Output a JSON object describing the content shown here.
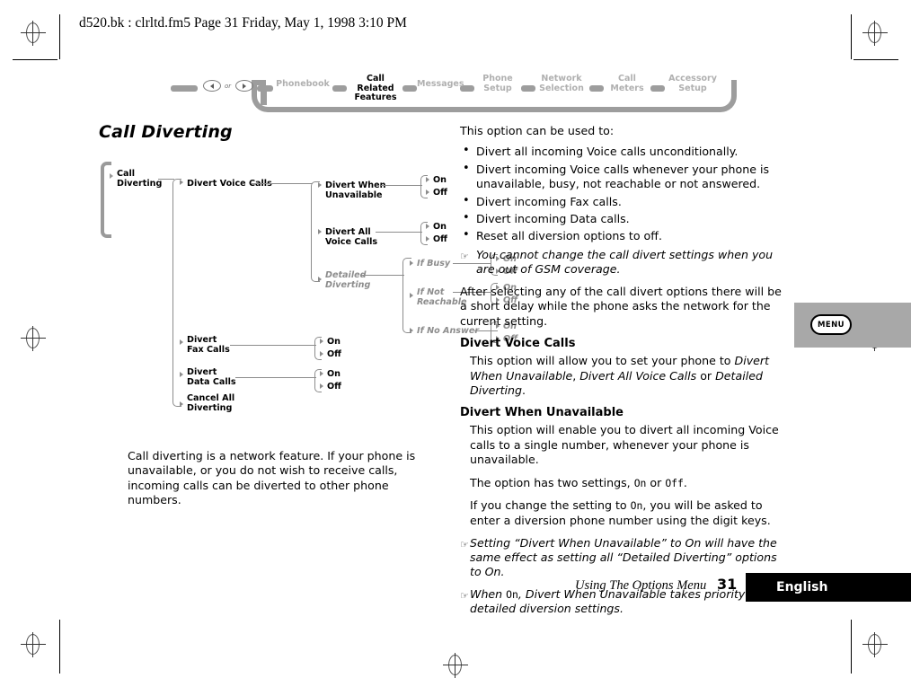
{
  "page_header": "d520.bk : clrltd.fm5  Page 31  Friday, May 1, 1998  3:10 PM",
  "nav": {
    "or_label": "or",
    "left_key_icon": "arrow-left-icon",
    "right_key_icon": "arrow-right-icon",
    "tabs": [
      {
        "label": "Phonebook",
        "active": false
      },
      {
        "label": "Call Related\nFeatures",
        "active": true
      },
      {
        "label": "Messages",
        "active": false
      },
      {
        "label": "Phone\nSetup",
        "active": false
      },
      {
        "label": "Network\nSelection",
        "active": false
      },
      {
        "label": "Call\nMeters",
        "active": false
      },
      {
        "label": "Accessory\nSetup",
        "active": false
      }
    ]
  },
  "heading": "Call Diverting",
  "diagram": {
    "root": "Call Diverting",
    "branches": [
      "Divert Voice Calls",
      "Divert Fax Calls",
      "Divert Data Calls",
      "Cancel All Diverting"
    ],
    "voice_children": [
      "Divert When Unavailable",
      "Divert All Voice Calls",
      "Detailed Diverting"
    ],
    "detailed_children": [
      "If Busy",
      "If Not Reachable",
      "If No Answer"
    ],
    "on": "On",
    "off": "Off"
  },
  "caption": "Call diverting is a network feature. If your phone is unavailable, or you do not wish to receive calls, incoming calls can be diverted to other phone numbers.",
  "right": {
    "intro": "This option can be used to:",
    "bullets": [
      "Divert all incoming Voice calls unconditionally.",
      "Divert incoming Voice calls whenever your phone is unavailable, busy, not reachable or not answered.",
      "Divert incoming Fax calls.",
      "Divert incoming Data calls.",
      "Reset all diversion options to off."
    ],
    "note_gsm": "You cannot change the call divert settings when you are out of GSM coverage.",
    "para_delay": "After selecting any of the call divert options there will be a short delay while the phone asks the network for the current setting.",
    "h2_voice": "Divert Voice Calls",
    "para_voice_1": "This option will allow you to set your phone to ",
    "para_voice_em1": "Divert When Unavailable",
    "para_voice_2": ", ",
    "para_voice_em2": "Divert All Voice Calls",
    "para_voice_3": " or ",
    "para_voice_em3": "Detailed Diverting",
    "para_voice_4": ".",
    "h2_unavailable": "Divert When Unavailable",
    "para_unav": "This option will enable you to divert all incoming Voice calls to a single number, whenever your phone is unavailable.",
    "para_settings_1": "The option has two settings, ",
    "para_settings_on": "On",
    "para_settings_2": " or ",
    "para_settings_off": "Off",
    "para_settings_3": ".",
    "para_change_1": "If you change the setting to ",
    "para_change_on": "On",
    "para_change_2": ", you will be asked to enter a diversion phone number using the digit keys.",
    "note_setting": "Setting “Divert When Unavailable” to On will have the same effect as setting all “Detailed Diverting” options to On.",
    "note_priority_1": "When ",
    "note_priority_on": "On",
    "note_priority_2": ", Divert When Unavailable takes priority over detailed diversion settings.",
    "hand_icon": "☞"
  },
  "menu_tab": {
    "button_label": "MENU"
  },
  "footer": {
    "title": "Using The Options Menu",
    "page_number": "31",
    "language": "English"
  }
}
